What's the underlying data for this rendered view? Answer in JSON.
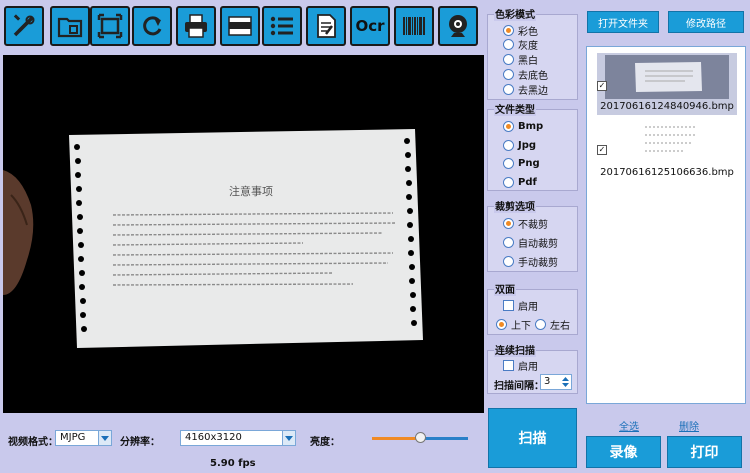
{
  "toolbar": {
    "icons": [
      "tools-icon",
      "folder-icon",
      "fullscreen-icon",
      "rotate-icon",
      "printer-icon",
      "crop-bar-icon",
      "list-icon",
      "document-edit-icon",
      "barcode-icon",
      "webcam-icon"
    ],
    "ocr_label": "Ocr"
  },
  "camera": {
    "document_title": "注意事项"
  },
  "bottom": {
    "video_format_label": "视频格式：",
    "video_format_value": "MJPG",
    "resolution_label": "分辨率：",
    "resolution_value": "4160x3120",
    "brightness_label": "亮度：",
    "brightness_level": 0.5,
    "fps": "5.90 fps"
  },
  "color_mode": {
    "title": "色彩模式",
    "options": [
      "彩色",
      "灰度",
      "黑白",
      "去底色",
      "去黑边"
    ],
    "selected": "彩色"
  },
  "file_type": {
    "title": "文件类型",
    "options": [
      "Bmp",
      "Jpg",
      "Png",
      "Pdf"
    ],
    "selected": "Bmp"
  },
  "crop": {
    "title": "裁剪选项",
    "options": [
      "不裁剪",
      "自动裁剪",
      "手动裁剪"
    ],
    "selected": "不裁剪"
  },
  "duplex": {
    "title": "双面",
    "enable_label": "启用",
    "orientation_options": [
      "上下",
      "左右"
    ],
    "selected": "上下"
  },
  "continuous": {
    "title": "连续扫描",
    "enable_label": "启用",
    "interval_label": "扫描间隔：",
    "interval_value": "3"
  },
  "scan_button": "扫描",
  "right": {
    "open_folder": "打开文件夹",
    "change_path": "修改路径",
    "files": [
      {
        "name": "20170616124840946.bmp",
        "checked": "✓"
      },
      {
        "name": "20170616125106636.bmp",
        "checked": "✓"
      }
    ],
    "select_all": "全选",
    "delete": "删除",
    "record": "录像",
    "print": "打印"
  },
  "colors": {
    "accent": "#1a9cd8",
    "panel_bg": "#c9c9ec",
    "radio_selected": "#f08a24"
  }
}
